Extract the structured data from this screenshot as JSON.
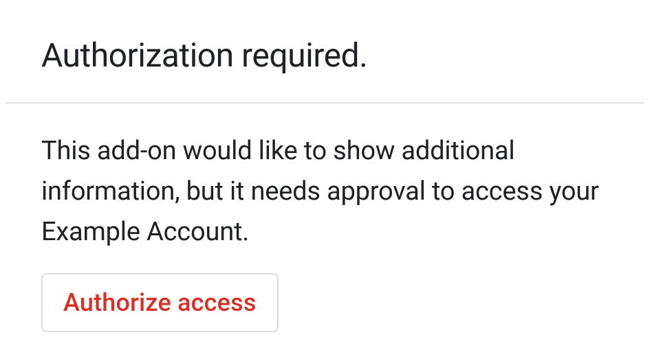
{
  "header": {
    "title": "Authorization required."
  },
  "content": {
    "description": "This add-on would like to show additional information, but it needs approval to access your Example Account.",
    "authorize_button_label": "Authorize access"
  }
}
